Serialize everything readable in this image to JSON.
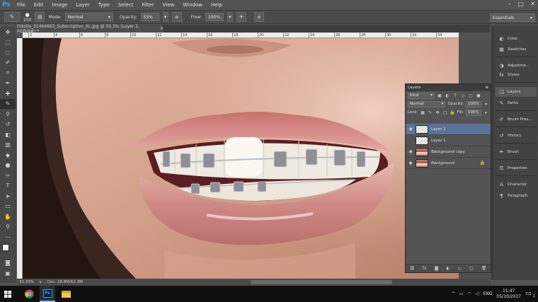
{
  "app": {
    "logo": "Ps",
    "menu": [
      "File",
      "Edit",
      "Image",
      "Layer",
      "Type",
      "Select",
      "Filter",
      "View",
      "Window",
      "Help"
    ],
    "window_controls": [
      "–",
      "□",
      "✕"
    ]
  },
  "options_bar": {
    "brush_size": "250",
    "mode_label": "Mode:",
    "mode_value": "Normal",
    "opacity_label": "Opacity:",
    "opacity_value": "55%",
    "flow_label": "Flow:",
    "flow_value": "100%",
    "workspace": "Essentials"
  },
  "document_tab": {
    "title": "Fotolia_31466663_Subscription_XL.jpg @ 33.3% (Layer 2, RGB/8#) *",
    "close": "×"
  },
  "ruler": {
    "ticks": [
      "2",
      "4",
      "6",
      "8",
      "10",
      "12",
      "14",
      "16",
      "18",
      "20",
      "22",
      "24",
      "26",
      "28",
      "30",
      "32",
      "34"
    ]
  },
  "status_bar": {
    "zoom": "33.33%",
    "doc_info": "Doc: 28.8M/62.3M"
  },
  "dock": {
    "items": [
      {
        "label": "Color",
        "icon": "color-icon",
        "glyph": "◐"
      },
      {
        "label": "Swatches",
        "icon": "swatches-icon",
        "glyph": "▦"
      },
      {
        "label": "Adjustme...",
        "icon": "adjustments-icon",
        "glyph": "◑"
      },
      {
        "label": "Styles",
        "icon": "styles-icon",
        "glyph": "fx"
      },
      {
        "label": "Layers",
        "icon": "layers-icon",
        "glyph": "❏"
      },
      {
        "label": "Paths",
        "icon": "paths-icon",
        "glyph": "✎"
      },
      {
        "label": "Brush Pres...",
        "icon": "brush-presets-icon",
        "glyph": "✐"
      },
      {
        "label": "History",
        "icon": "history-icon",
        "glyph": "↺"
      },
      {
        "label": "Brush",
        "icon": "brush-icon",
        "glyph": "✒"
      },
      {
        "label": "Properties",
        "icon": "properties-icon",
        "glyph": "☰"
      },
      {
        "label": "Character",
        "icon": "character-icon",
        "glyph": "A"
      },
      {
        "label": "Paragraph",
        "icon": "paragraph-icon",
        "glyph": "¶"
      }
    ]
  },
  "layers_panel": {
    "title": "Layers",
    "filter": "Kind",
    "blend_mode": "Normal",
    "opacity_label": "Opacity:",
    "opacity_value": "100%",
    "lock_label": "Lock:",
    "fill_label": "Fill:",
    "fill_value": "100%",
    "layers": [
      {
        "name": "Layer 2",
        "visible": true,
        "selected": true,
        "thumb": "transparent",
        "locked": false
      },
      {
        "name": "Layer 1",
        "visible": false,
        "selected": false,
        "thumb": "transparent",
        "locked": false
      },
      {
        "name": "Background copy",
        "visible": true,
        "selected": false,
        "thumb": "photo",
        "locked": false
      },
      {
        "name": "Background",
        "visible": true,
        "selected": false,
        "thumb": "photo",
        "locked": true
      }
    ]
  },
  "taskbar": {
    "language": "ENG",
    "time": "11:47",
    "date": "05/10/2017",
    "notifications": "1"
  },
  "colors": {
    "chrome": "#535353",
    "selection": "#5c7196",
    "ps_blue": "#31a8ff"
  }
}
